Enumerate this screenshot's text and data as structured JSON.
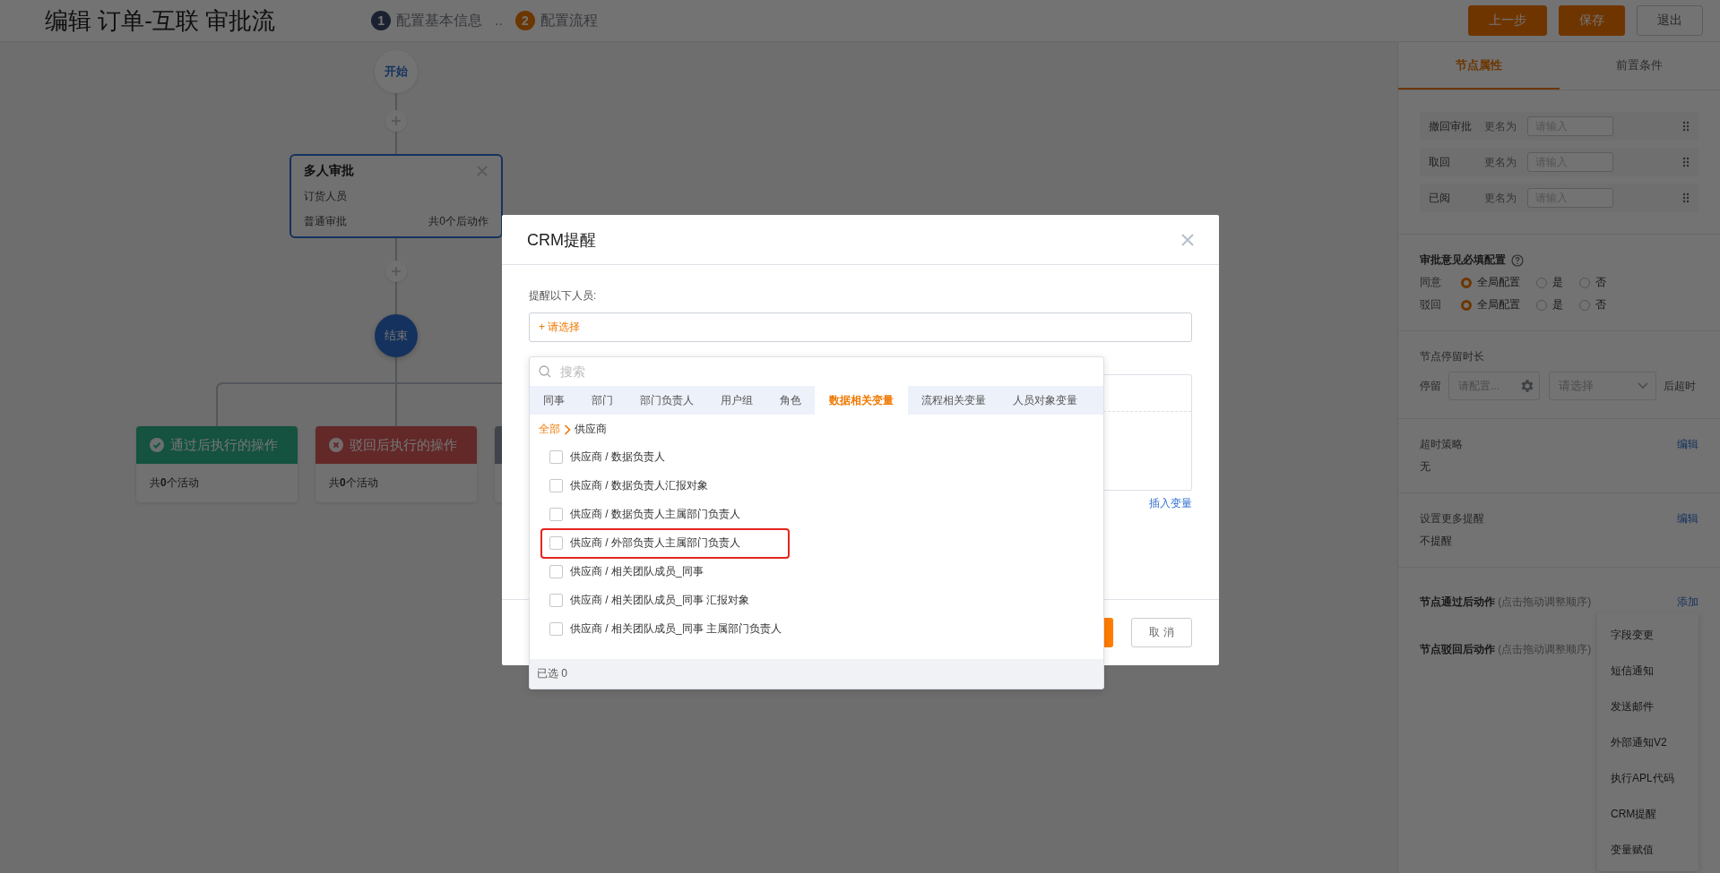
{
  "header": {
    "title": "编辑 订单-互联 审批流",
    "steps": [
      {
        "number": "1",
        "label": "配置基本信息",
        "selected": false
      },
      {
        "number": "2",
        "label": "配置流程",
        "selected": true
      }
    ],
    "step_separator": "..",
    "buttons": [
      {
        "label": "上一步",
        "kind": "primary"
      },
      {
        "label": "保存",
        "kind": "primary"
      },
      {
        "label": "退出",
        "kind": "default"
      }
    ]
  },
  "flow": {
    "start": "开始",
    "approval_node": {
      "title": "多人审批",
      "assignee": "订货人员",
      "type": "普通审批",
      "actions": "共0个后动作",
      "selected": true
    },
    "end": "结束",
    "branches": [
      {
        "kind": "pass",
        "title": "通过后执行的操作",
        "summary": "共**0**个活动"
      },
      {
        "kind": "reject",
        "title": "驳回后执行的操作",
        "summary": "共**0**个活动"
      },
      {
        "kind": "other"
      }
    ]
  },
  "panel": {
    "tabs": [
      {
        "label": "节点属性",
        "selected": true
      },
      {
        "label": "前置条件",
        "selected": false
      }
    ],
    "rename_rows": [
      {
        "action": "撤回审批",
        "label": "更名为",
        "placeholder": "请输入"
      },
      {
        "action": "取回",
        "label": "更名为",
        "placeholder": "请输入"
      },
      {
        "action": "已阅",
        "label": "更名为",
        "placeholder": "请输入"
      }
    ],
    "opinion": {
      "title": "审批意见必填配置",
      "rows": [
        {
          "label": "同意",
          "options": [
            {
              "label": "全局配置",
              "selected": true
            },
            {
              "label": "是",
              "selected": false
            },
            {
              "label": "否",
              "selected": false
            }
          ]
        },
        {
          "label": "驳回",
          "options": [
            {
              "label": "全局配置",
              "selected": true
            },
            {
              "label": "是",
              "selected": false
            },
            {
              "label": "否",
              "selected": false
            }
          ]
        }
      ]
    },
    "stay": {
      "title": "节点停留时长",
      "label": "停留",
      "duration_placeholder": "请配置...",
      "unit_placeholder": "请选择",
      "suffix": "后超时"
    },
    "timeout": {
      "title": "超时策略",
      "value": "无",
      "edit": "编辑"
    },
    "reminders": {
      "title": "设置更多提醒",
      "value": "不提醒",
      "edit": "编辑"
    },
    "pass_actions": {
      "title": "节点通过后动作",
      "hint": "(点击拖动调整顺序)",
      "add": "添加"
    },
    "reject_actions": {
      "title": "节点驳回后动作",
      "hint": "(点击拖动调整顺序)"
    },
    "add_menu": [
      "字段变更",
      "短信通知",
      "发送邮件",
      "外部通知V2",
      "执行APL代码",
      "CRM提醒",
      "变量赋值"
    ]
  },
  "modal": {
    "title": "CRM提醒",
    "recipients_label": "提醒以下人员:",
    "select_link": "+ 请选择",
    "insert_variable": "插入变量",
    "cancel": "取 消"
  },
  "picker": {
    "search_placeholder": "搜索",
    "tabs": [
      {
        "label": "同事",
        "selected": false
      },
      {
        "label": "部门",
        "selected": false
      },
      {
        "label": "部门负责人",
        "selected": false
      },
      {
        "label": "用户组",
        "selected": false
      },
      {
        "label": "角色",
        "selected": false
      },
      {
        "label": "数据相关变量",
        "selected": true
      },
      {
        "label": "流程相关变量",
        "selected": false
      },
      {
        "label": "人员对象变量",
        "selected": false
      }
    ],
    "breadcrumb": [
      "全部",
      "供应商"
    ],
    "options": [
      {
        "label": "供应商 / 数据负责人",
        "checked": false,
        "highlighted": false
      },
      {
        "label": "供应商 / 数据负责人汇报对象",
        "checked": false,
        "highlighted": false
      },
      {
        "label": "供应商 / 数据负责人主属部门负责人",
        "checked": false,
        "highlighted": false
      },
      {
        "label": "供应商 / 外部负责人主属部门负责人",
        "checked": false,
        "highlighted": true
      },
      {
        "label": "供应商 / 相关团队成员_同事",
        "checked": false,
        "highlighted": false
      },
      {
        "label": "供应商 / 相关团队成员_同事 汇报对象",
        "checked": false,
        "highlighted": false
      },
      {
        "label": "供应商 / 相关团队成员_同事 主属部门负责人",
        "checked": false,
        "highlighted": false
      }
    ],
    "footer": "已选 0"
  }
}
